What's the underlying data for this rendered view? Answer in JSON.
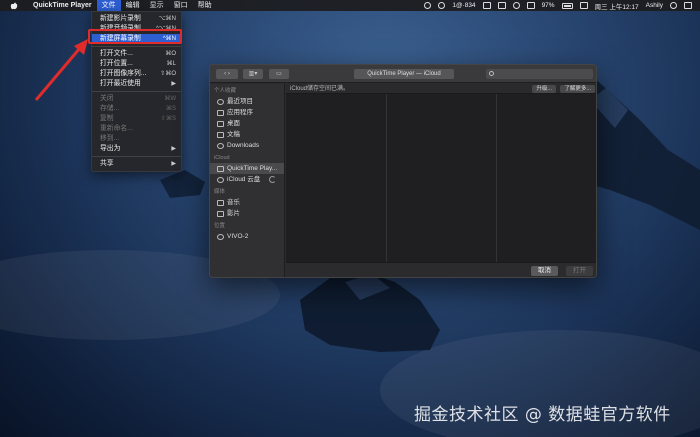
{
  "menubar": {
    "app_name": "QuickTime Player",
    "menus": [
      "文件",
      "编辑",
      "显示",
      "窗口",
      "帮助"
    ],
    "status": {
      "dropbox": "1@·834",
      "battery": "97%",
      "datetime": "周三 上午12:17",
      "user": "Ashily"
    }
  },
  "file_menu": {
    "items": [
      {
        "label": "新建影片录制",
        "shortcut": "⌥⌘N",
        "state": "normal"
      },
      {
        "label": "新建音频录制",
        "shortcut": "^⌥⌘N",
        "state": "normal"
      },
      {
        "label": "新建屏幕录制",
        "shortcut": "^⌘N",
        "state": "highlighted"
      },
      {
        "label": "打开文件...",
        "shortcut": "⌘O",
        "state": "normal"
      },
      {
        "label": "打开位置...",
        "shortcut": "⌘L",
        "state": "normal"
      },
      {
        "label": "打开图像序列...",
        "shortcut": "⇧⌘O",
        "state": "normal"
      },
      {
        "label": "打开最近使用",
        "shortcut": "▶",
        "state": "normal"
      },
      {
        "label": "关闭",
        "shortcut": "⌘W",
        "state": "disabled"
      },
      {
        "label": "存储...",
        "shortcut": "⌘S",
        "state": "disabled"
      },
      {
        "label": "复制",
        "shortcut": "⇧⌘S",
        "state": "disabled"
      },
      {
        "label": "重新命名...",
        "shortcut": "",
        "state": "disabled"
      },
      {
        "label": "移到...",
        "shortcut": "",
        "state": "disabled"
      },
      {
        "label": "导出为",
        "shortcut": "▶",
        "state": "normal"
      },
      {
        "label": "共享",
        "shortcut": "▶",
        "state": "normal"
      }
    ]
  },
  "dialog": {
    "path_popup": "QuickTime Player — iCloud",
    "info_message": "iCloud储存空间已满。",
    "upgrade_button": "升级...",
    "learn_more_button": "了解更多...",
    "sidebar": {
      "favorites_header": "个人收藏",
      "favorites": [
        "最近项目",
        "应用程序",
        "桌面",
        "文稿",
        "Downloads"
      ],
      "icloud_header": "iCloud",
      "icloud": [
        "QuickTime Play...",
        "iCloud 云盘"
      ],
      "media_header": "媒体",
      "media": [
        "音乐",
        "影片"
      ],
      "locations_header": "位置",
      "locations": [
        "VIVO-2"
      ]
    },
    "cancel_button": "取消",
    "open_button": "打开"
  },
  "watermark": "掘金技术社区 @ 数据蛙官方软件",
  "colors": {
    "accent": "#2d5fd3",
    "annotation": "#e02b2b"
  }
}
